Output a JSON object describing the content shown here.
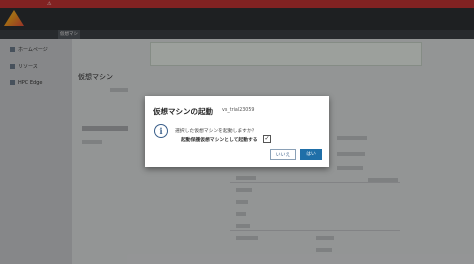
{
  "dialog": {
    "title": "仮想マシンの起動",
    "vm_name": "vs_trial23059",
    "question": "選択した仮想マシンを起動しますか？",
    "checkbox_label": "起動保護仮想マシンとして起動する",
    "checkbox_checked": true,
    "checkbox_mark": "✓",
    "no_button": "いいえ",
    "yes_button": "はい"
  },
  "page": {
    "title": "仮想マシン",
    "sidebar": [
      {
        "label": "ホームページ"
      },
      {
        "label": "リソース"
      },
      {
        "label": "HPC Edge"
      }
    ],
    "nav_tab": "仮想マシン"
  },
  "colors": {
    "banner": "#c03434",
    "header": "#2e3134",
    "primary_button": "#1f6fa8"
  }
}
